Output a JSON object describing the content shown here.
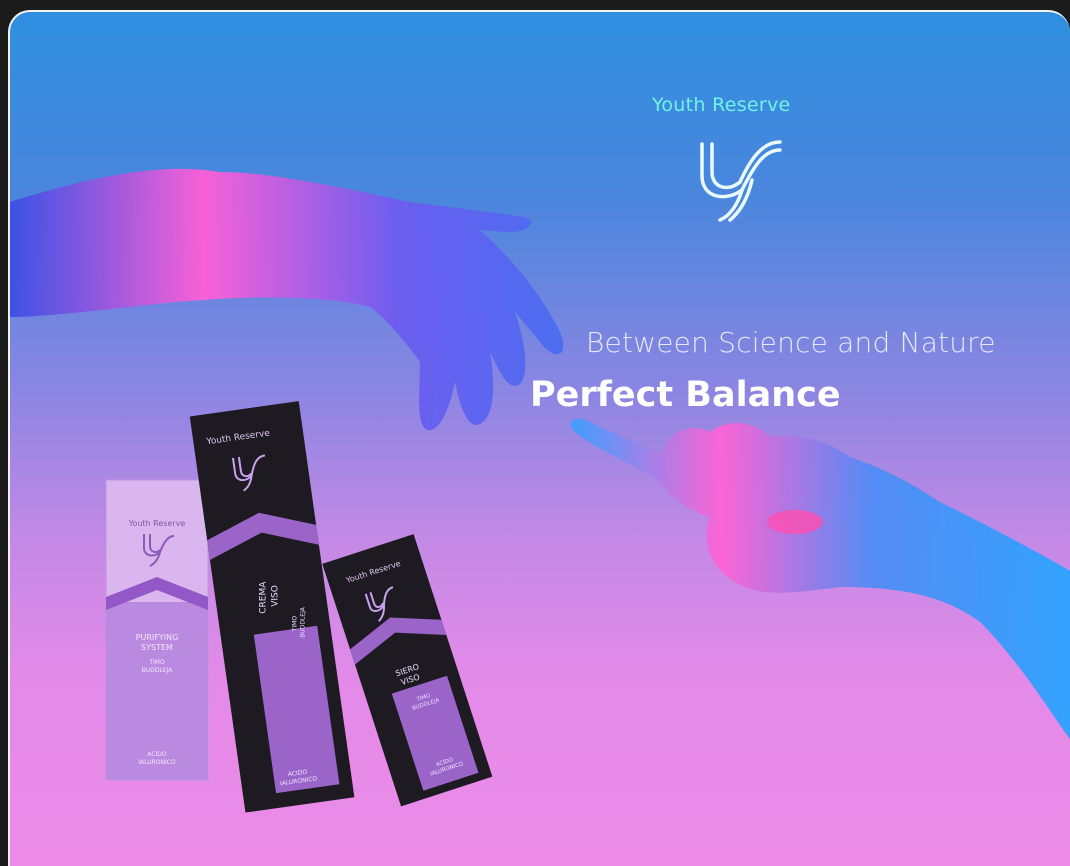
{
  "ad": {
    "brand": "Youth Reserve",
    "tagline": "Between Science and Nature",
    "headline": "Perfect Balance"
  },
  "products": {
    "light_box": {
      "brand": "Youth Reserve",
      "line1": "PURIFYING",
      "line2": "SYSTEM",
      "sub1": "TIMO",
      "sub2": "BUDDLEJA",
      "bottom1": "ACIDO",
      "bottom2": "IALURONICO"
    },
    "tall_box": {
      "brand": "Youth Reserve",
      "line1": "CREMA",
      "line2": "VISO",
      "sub1": "TIMO",
      "sub2": "BUDDLEJA",
      "bottom1": "ACIDO",
      "bottom2": "IALURONICO"
    },
    "short_box": {
      "brand": "Youth Reserve",
      "line1": "SIERO",
      "line2": "VISO",
      "sub1": "TIMO",
      "sub2": "BUDDLEJA",
      "bottom1": "ACIDO",
      "bottom2": "IALURONICO"
    }
  },
  "colors": {
    "background_top": "#2f8fe0",
    "background_bottom": "#ec8be8",
    "brand_accent": "#6ff3e4",
    "box_dark": "#1e1a22",
    "box_purple": "#9a64c9"
  },
  "icons": {
    "logo": "youth-reserve-logo-icon"
  }
}
